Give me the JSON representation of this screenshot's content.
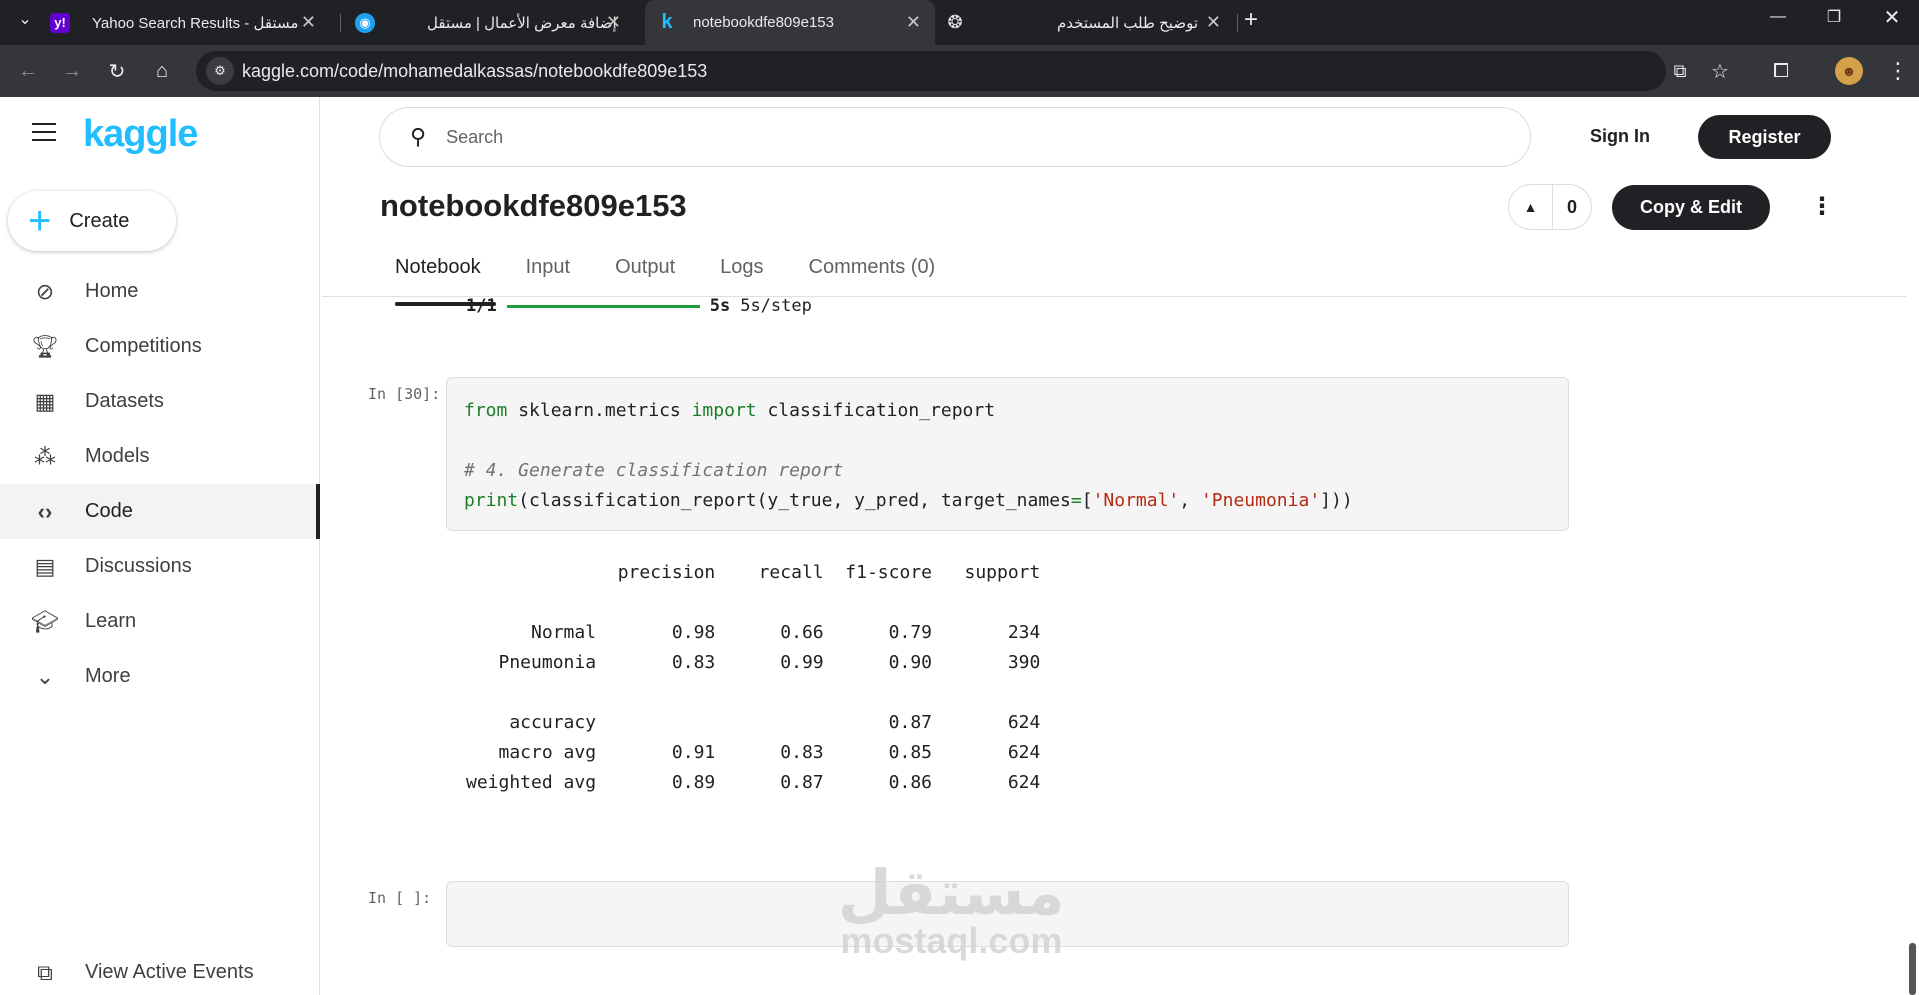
{
  "browser": {
    "tabs": [
      {
        "title": "Yahoo Search Results - مستقل",
        "favicon": "yahoo-icon"
      },
      {
        "title": "إضافة معرض الأعمال | مستقل",
        "favicon": "mostaql-icon"
      },
      {
        "title": "notebookdfe809e153",
        "favicon": "kaggle-k-icon",
        "active": true
      },
      {
        "title": "توضيح طلب المستخدم",
        "favicon": "chatgpt-icon"
      }
    ],
    "url": "kaggle.com/code/mohamedalkassas/notebookdfe809e153"
  },
  "sidebar": {
    "logo": "kaggle",
    "create_label": "Create",
    "items": [
      {
        "label": "Home",
        "icon": "compass-icon"
      },
      {
        "label": "Competitions",
        "icon": "trophy-icon"
      },
      {
        "label": "Datasets",
        "icon": "table-icon"
      },
      {
        "label": "Models",
        "icon": "models-icon"
      },
      {
        "label": "Code",
        "icon": "code-icon",
        "active": true
      },
      {
        "label": "Discussions",
        "icon": "comment-icon"
      },
      {
        "label": "Learn",
        "icon": "school-icon"
      },
      {
        "label": "More",
        "icon": "chevron-down-icon"
      }
    ],
    "view_events_label": "View Active Events"
  },
  "header": {
    "search_placeholder": "Search",
    "signin_label": "Sign In",
    "register_label": "Register"
  },
  "notebook": {
    "title": "notebookdfe809e153",
    "vote_count": "0",
    "copy_edit_label": "Copy & Edit",
    "tabs": [
      "Notebook",
      "Input",
      "Output",
      "Logs",
      "Comments (0)"
    ],
    "progress": {
      "steps": "1/1",
      "time": "5s",
      "rate": "5s/step",
      "fraction": 1.0
    },
    "cells": [
      {
        "prompt": "In [30]:",
        "code_lines": [
          "from sklearn.metrics import classification_report",
          "",
          "# 4. Generate classification report",
          "print(classification_report(y_true, y_pred, target_names=['Normal', 'Pneumonia']))"
        ]
      },
      {
        "prompt": "In [ ]:",
        "code_lines": []
      }
    ],
    "output": {
      "header": [
        "",
        "precision",
        "recall",
        "f1-score",
        "support"
      ],
      "rows": [
        [
          "Normal",
          "0.98",
          "0.66",
          "0.79",
          "234"
        ],
        [
          "Pneumonia",
          "0.83",
          "0.99",
          "0.90",
          "390"
        ],
        [],
        [
          "accuracy",
          "",
          "",
          "0.87",
          "624"
        ],
        [
          "macro avg",
          "0.91",
          "0.83",
          "0.85",
          "624"
        ],
        [
          "weighted avg",
          "0.89",
          "0.87",
          "0.86",
          "624"
        ]
      ]
    }
  },
  "watermark": {
    "arabic": "مستقل",
    "latin": "mostaql.com"
  },
  "colors": {
    "kaggle_blue": "#20beff",
    "progress_green": "#1e9e3f",
    "keyword_green": "#1d7d28",
    "string_red": "#b22b12"
  }
}
